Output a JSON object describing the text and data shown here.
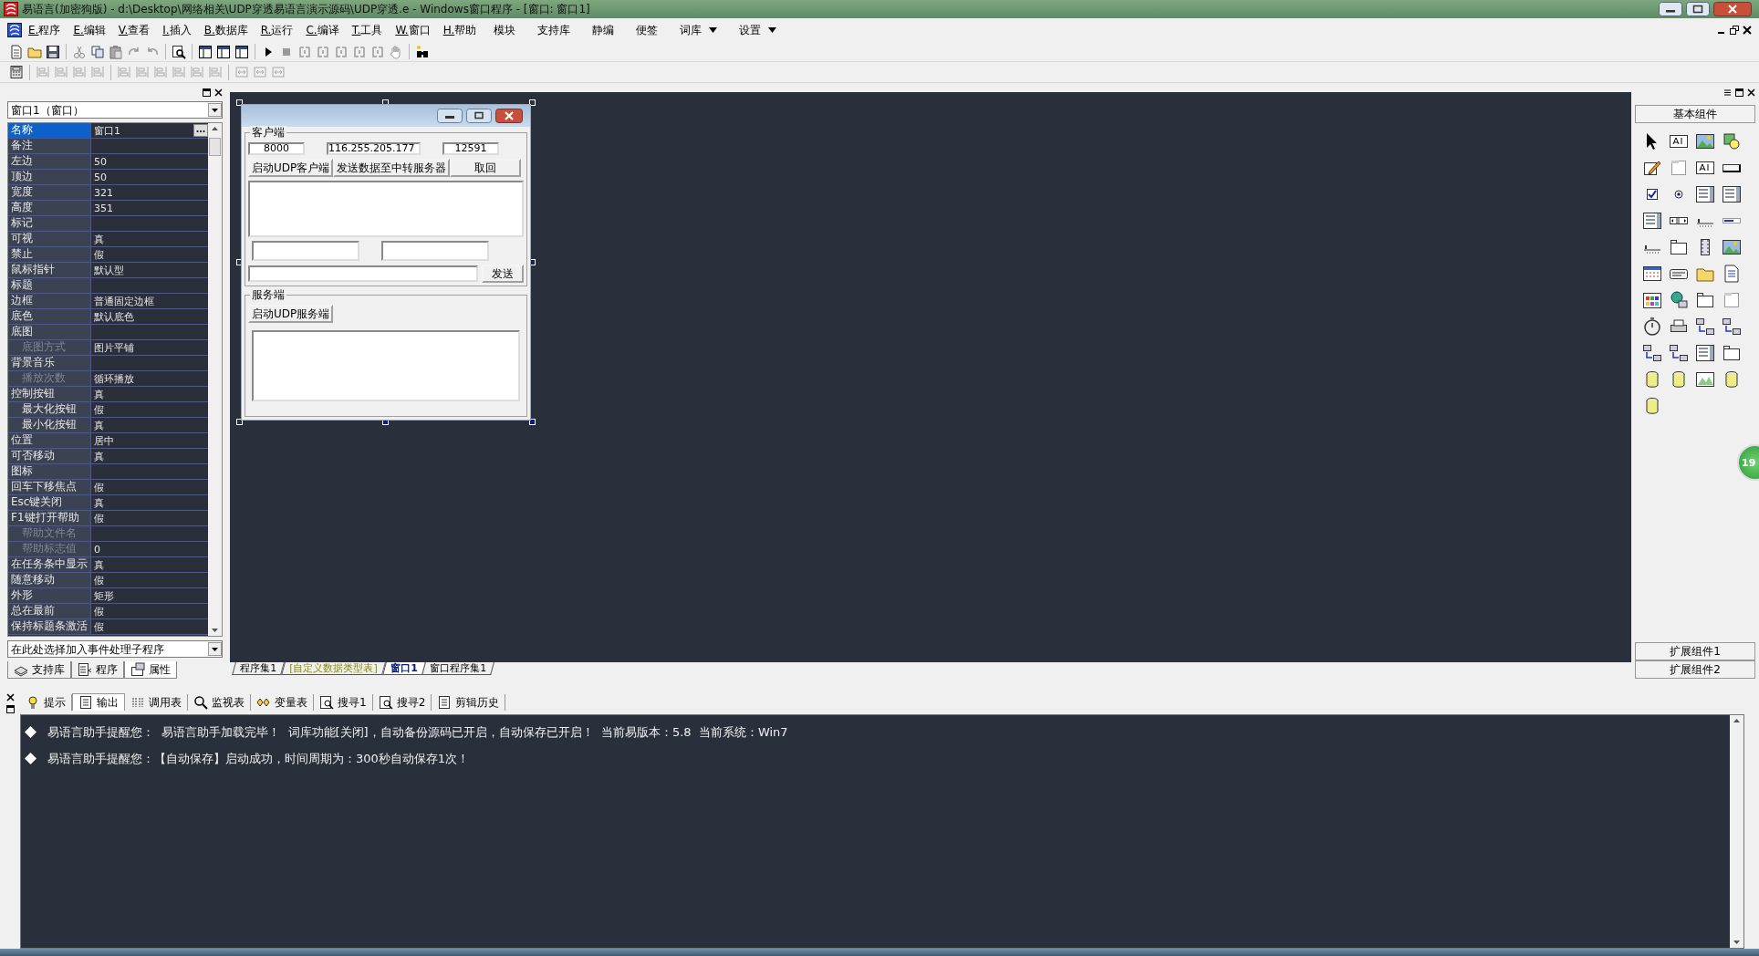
{
  "window": {
    "title": "易语言(加密狗版) - d:\\Desktop\\网络相关\\UDP穿透易语言演示源码\\UDP穿透.e - Windows窗口程序 - [窗口: 窗口1]"
  },
  "menu": [
    {
      "label": "E.程序"
    },
    {
      "label": "E.编辑"
    },
    {
      "label": "V.查看"
    },
    {
      "label": "I.插入"
    },
    {
      "label": "B.数据库"
    },
    {
      "label": "R.运行"
    },
    {
      "label": "C.编译"
    },
    {
      "label": "T.工具"
    },
    {
      "label": "W.窗口"
    },
    {
      "label": "H.帮助"
    }
  ],
  "extra_menu": [
    {
      "label": "模块",
      "dropdown": false
    },
    {
      "label": "支持库",
      "dropdown": false
    },
    {
      "label": "静编",
      "dropdown": false
    },
    {
      "label": "便签",
      "dropdown": false
    },
    {
      "label": "词库",
      "dropdown": true
    },
    {
      "label": "设置",
      "dropdown": true
    }
  ],
  "property_panel": {
    "object_selector": "窗口1（窗口）",
    "rows": [
      {
        "name": "名称",
        "value": "窗口1",
        "selected": true,
        "sub": false,
        "disabled": false
      },
      {
        "name": "备注",
        "value": "",
        "selected": false,
        "sub": false,
        "disabled": false
      },
      {
        "name": "左边",
        "value": "50",
        "selected": false,
        "sub": false,
        "disabled": false
      },
      {
        "name": "顶边",
        "value": "50",
        "selected": false,
        "sub": false,
        "disabled": false
      },
      {
        "name": "宽度",
        "value": "321",
        "selected": false,
        "sub": false,
        "disabled": false
      },
      {
        "name": "高度",
        "value": "351",
        "selected": false,
        "sub": false,
        "disabled": false
      },
      {
        "name": "标记",
        "value": "",
        "selected": false,
        "sub": false,
        "disabled": false
      },
      {
        "name": "可视",
        "value": "真",
        "selected": false,
        "sub": false,
        "disabled": false
      },
      {
        "name": "禁止",
        "value": "假",
        "selected": false,
        "sub": false,
        "disabled": false
      },
      {
        "name": "鼠标指针",
        "value": "默认型",
        "selected": false,
        "sub": false,
        "disabled": false
      },
      {
        "name": "标题",
        "value": "",
        "selected": false,
        "sub": false,
        "disabled": false
      },
      {
        "name": "边框",
        "value": "普通固定边框",
        "selected": false,
        "sub": false,
        "disabled": false
      },
      {
        "name": "底色",
        "value": "默认底色",
        "selected": false,
        "sub": false,
        "disabled": false
      },
      {
        "name": "底图",
        "value": "",
        "selected": false,
        "sub": false,
        "disabled": false
      },
      {
        "name": "底图方式",
        "value": "图片平铺",
        "selected": false,
        "sub": true,
        "disabled": true
      },
      {
        "name": "背景音乐",
        "value": "",
        "selected": false,
        "sub": false,
        "disabled": false
      },
      {
        "name": "播放次数",
        "value": "循环播放",
        "selected": false,
        "sub": true,
        "disabled": true
      },
      {
        "name": "控制按钮",
        "value": "真",
        "selected": false,
        "sub": false,
        "disabled": false
      },
      {
        "name": "最大化按钮",
        "value": "假",
        "selected": false,
        "sub": true,
        "disabled": false
      },
      {
        "name": "最小化按钮",
        "value": "真",
        "selected": false,
        "sub": true,
        "disabled": false
      },
      {
        "name": "位置",
        "value": "居中",
        "selected": false,
        "sub": false,
        "disabled": false
      },
      {
        "name": "可否移动",
        "value": "真",
        "selected": false,
        "sub": false,
        "disabled": false
      },
      {
        "name": "图标",
        "value": "",
        "selected": false,
        "sub": false,
        "disabled": false
      },
      {
        "name": "回车下移焦点",
        "value": "假",
        "selected": false,
        "sub": false,
        "disabled": false
      },
      {
        "name": "Esc键关闭",
        "value": "真",
        "selected": false,
        "sub": false,
        "disabled": false
      },
      {
        "name": "F1键打开帮助",
        "value": "假",
        "selected": false,
        "sub": false,
        "disabled": false
      },
      {
        "name": "帮助文件名",
        "value": "",
        "selected": false,
        "sub": true,
        "disabled": true
      },
      {
        "name": "帮助标志值",
        "value": "0",
        "selected": false,
        "sub": true,
        "disabled": true
      },
      {
        "name": "在任务条中显示",
        "value": "真",
        "selected": false,
        "sub": false,
        "disabled": false
      },
      {
        "name": "随意移动",
        "value": "假",
        "selected": false,
        "sub": false,
        "disabled": false
      },
      {
        "name": "外形",
        "value": "矩形",
        "selected": false,
        "sub": false,
        "disabled": false
      },
      {
        "name": "总在最前",
        "value": "假",
        "selected": false,
        "sub": false,
        "disabled": false
      },
      {
        "name": "保持标题条激活",
        "value": "假",
        "selected": false,
        "sub": false,
        "disabled": false
      }
    ],
    "event_selector": "在此处选择加入事件处理子程序",
    "tabs": [
      {
        "label": "支持库",
        "selected": false
      },
      {
        "label": "程序",
        "selected": false
      },
      {
        "label": "属性",
        "selected": true
      }
    ]
  },
  "designer": {
    "client_group": {
      "title": "客户端",
      "port": "8000",
      "ip": "116.255.205.177",
      "remote_port": "12591",
      "buttons": [
        "启动UDP客户端",
        "发送数据至中转服务器",
        "取回"
      ],
      "send_button": "发送"
    },
    "server_group": {
      "title": "服务端",
      "button": "启动UDP服务端"
    }
  },
  "editor_tabs": [
    {
      "label": "程序集1",
      "kind": "normal",
      "selected": false
    },
    {
      "label": "[自定义数据类型表]",
      "kind": "datatype",
      "selected": false
    },
    {
      "label": "窗口1",
      "kind": "normal",
      "selected": true
    },
    {
      "label": "窗口程序集1",
      "kind": "normal",
      "selected": false
    }
  ],
  "toolbox": {
    "title": "基本组件",
    "footer_buttons": [
      "扩展组件1",
      "扩展组件2"
    ]
  },
  "floating_badge": "19",
  "output_tabs": [
    {
      "label": "提示",
      "selected": false
    },
    {
      "label": "输出",
      "selected": true
    },
    {
      "label": "调用表",
      "selected": false
    },
    {
      "label": "监视表",
      "selected": false
    },
    {
      "label": "变量表",
      "selected": false
    },
    {
      "label": "搜寻1",
      "selected": false
    },
    {
      "label": "搜寻2",
      "selected": false
    },
    {
      "label": "剪辑历史",
      "selected": false
    }
  ],
  "output_lines": [
    "易语言助手提醒您：  易语言助手加载完毕！  词库功能[关闭]，自动备份源码已开启，自动保存已开启！  当前易版本：5.8  当前系统：Win7",
    "易语言助手提醒您：【自动保存】启动成功，时间周期为：300秒自动保存1次！"
  ]
}
